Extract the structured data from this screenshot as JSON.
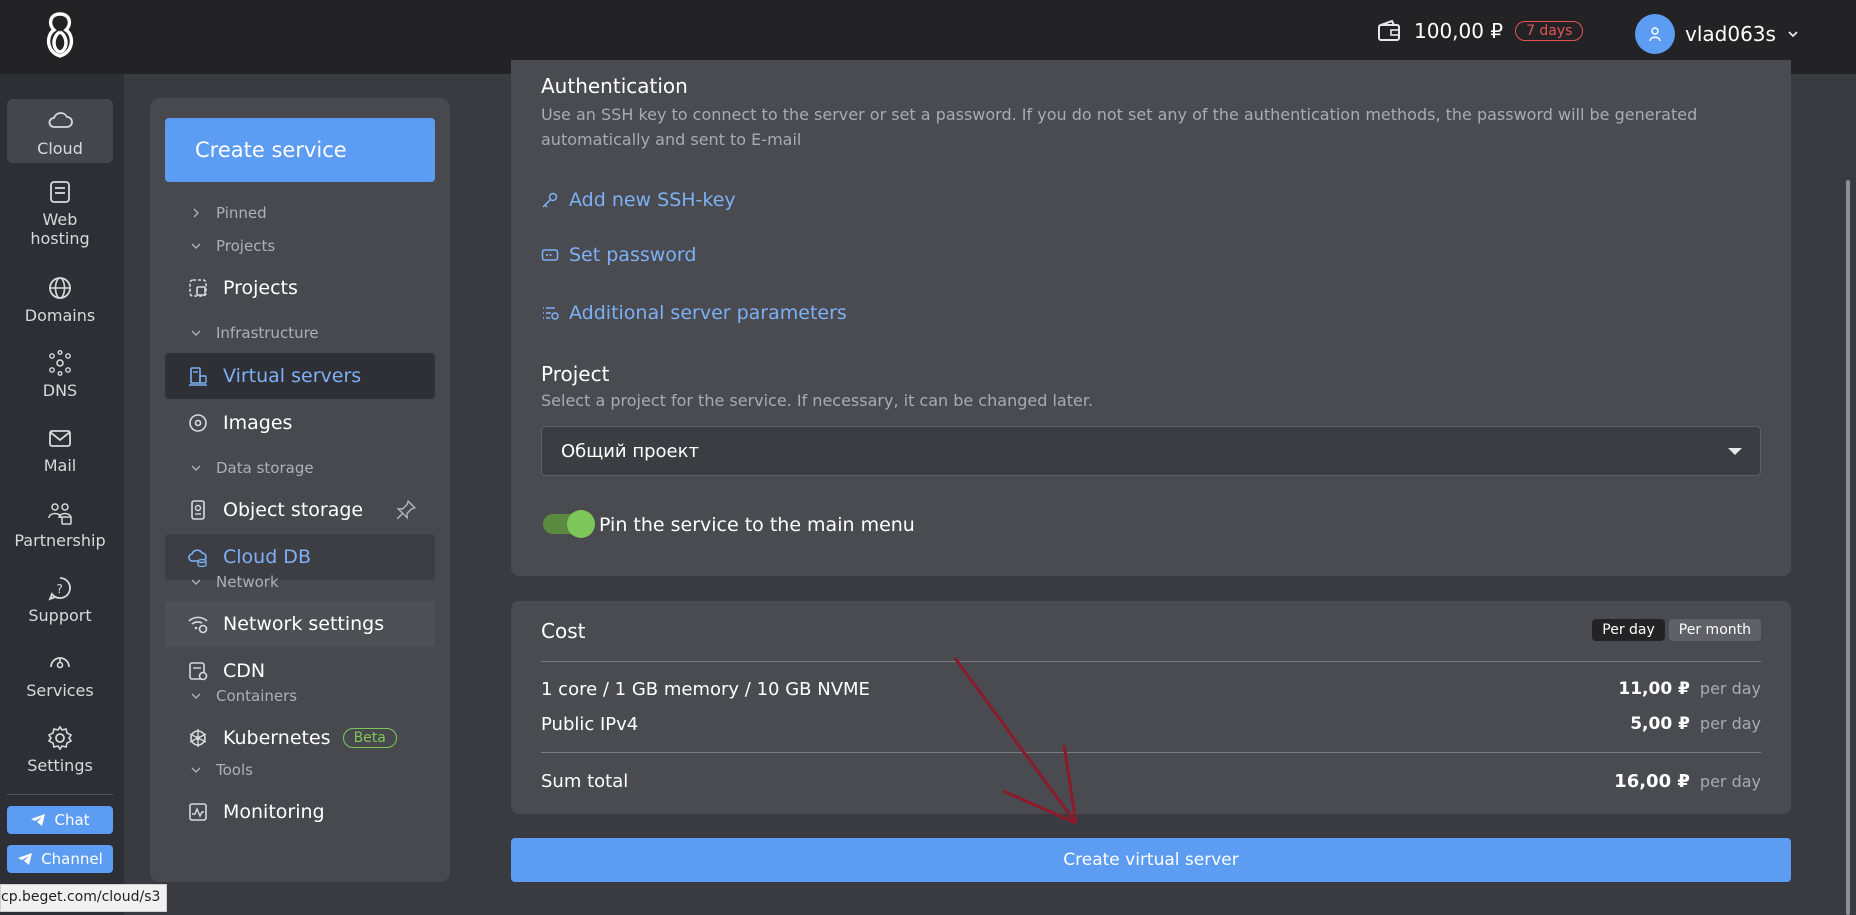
{
  "header": {
    "balance": "100,00 ₽",
    "days_badge": "7 days",
    "username": "vlad063s"
  },
  "rail": {
    "items": [
      {
        "label": "Cloud",
        "icon": "cloud-icon"
      },
      {
        "label": "Web\nhosting",
        "icon": "web-hosting-icon"
      },
      {
        "label": "Domains",
        "icon": "globe-icon"
      },
      {
        "label": "DNS",
        "icon": "dns-icon"
      },
      {
        "label": "Mail",
        "icon": "mail-icon"
      },
      {
        "label": "Partnership",
        "icon": "partnership-icon"
      },
      {
        "label": "Support",
        "icon": "support-icon"
      },
      {
        "label": "Services",
        "icon": "services-icon"
      },
      {
        "label": "Settings",
        "icon": "gear-icon"
      }
    ],
    "chat": "Chat",
    "channel": "Channel"
  },
  "sidebar": {
    "create_service": "Create service",
    "groups": {
      "pinned": "Pinned",
      "projects": "Projects",
      "infrastructure": "Infrastructure",
      "data_storage": "Data storage",
      "network": "Network",
      "containers": "Containers",
      "tools": "Tools"
    },
    "items": {
      "projects": "Projects",
      "virtual_servers": "Virtual servers",
      "images": "Images",
      "object_storage": "Object storage",
      "cloud_db": "Cloud DB",
      "network_settings": "Network settings",
      "cdn": "CDN",
      "kubernetes": "Kubernetes",
      "monitoring": "Monitoring"
    },
    "beta": "Beta"
  },
  "auth": {
    "title": "Authentication",
    "description": "Use an SSH key to connect to the server or set a password. If you do not set any of the authentication methods, the password will be generated automatically and sent to E-mail",
    "add_ssh": "Add new SSH-key",
    "set_password": "Set password",
    "additional_params": "Additional server parameters"
  },
  "project": {
    "title": "Project",
    "description": "Select a project for the service. If necessary, it can be changed later.",
    "selected": "Общий проект",
    "pin_label": "Pin the service to the main menu",
    "pin_enabled": true
  },
  "cost": {
    "title": "Cost",
    "per_day": "Per day",
    "per_month": "Per month",
    "selected_period": "Per day",
    "rows": [
      {
        "label": "1 core / 1 GB memory / 10 GB NVME",
        "amount": "11,00 ₽",
        "unit": "per day"
      },
      {
        "label": "Public IPv4",
        "amount": "5,00 ₽",
        "unit": "per day"
      }
    ],
    "total_label": "Sum total",
    "total_amount": "16,00 ₽",
    "total_unit": "per day"
  },
  "create_button": "Create virtual server",
  "status_url": "cp.beget.com/cloud/s3",
  "colors": {
    "accent": "#5c9cf2",
    "danger": "#e25555",
    "success": "#7dc75a",
    "annotation_arrow": "#8b1a2b"
  }
}
